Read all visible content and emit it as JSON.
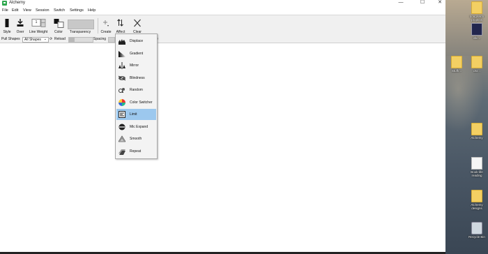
{
  "window": {
    "title": "Alchemy",
    "controls": {
      "minimize": "—",
      "maximize": "☐",
      "close": "✕"
    }
  },
  "menu": [
    "File",
    "Edit",
    "View",
    "Session",
    "Switch",
    "Settings",
    "Help"
  ],
  "toolbar": {
    "style": "Style",
    "over": "Over",
    "line_weight": "Line Weight",
    "line_weight_value": "1",
    "color": "Color",
    "transparency": "Transparency",
    "create": "Create",
    "affect": "Affect",
    "clear": "Clear"
  },
  "subtoolbar": {
    "pull_shapes": "Pull Shapes",
    "shape_select": "All Shapes",
    "reload": "Reload",
    "spacing": "Spacing",
    "trailing": "e"
  },
  "affect_menu": {
    "items": [
      {
        "label": "Displace",
        "icon": "displace-icon"
      },
      {
        "label": "Gradient",
        "icon": "gradient-icon"
      },
      {
        "label": "Mirror",
        "icon": "mirror-icon"
      },
      {
        "label": "Blindness",
        "icon": "blindness-icon"
      },
      {
        "label": "Random",
        "icon": "random-icon"
      },
      {
        "label": "Color Switcher",
        "icon": "color-switcher-icon"
      },
      {
        "label": "Limit",
        "icon": "limit-icon"
      },
      {
        "label": "Mic Expand",
        "icon": "mic-expand-icon"
      },
      {
        "label": "Smooth",
        "icon": "smooth-icon"
      },
      {
        "label": "Repeat",
        "icon": "repeat-icon"
      }
    ],
    "selected_index": 6,
    "selected_color": "#9cc8ee"
  },
  "desktop": {
    "icons": [
      {
        "label": "Long-term projects",
        "type": "folder"
      },
      {
        "label": "ink/...",
        "type": "app"
      },
      {
        "label": "Stuff/...",
        "type": "folder"
      },
      {
        "label": "dsr...",
        "type": "folder"
      },
      {
        "label": "Alchemy",
        "type": "folder"
      },
      {
        "label": "Book-life reading",
        "type": "doc"
      },
      {
        "label": "Alchemy designs",
        "type": "folder"
      },
      {
        "label": "Recycle Bin",
        "type": "recycle-bin"
      }
    ]
  }
}
